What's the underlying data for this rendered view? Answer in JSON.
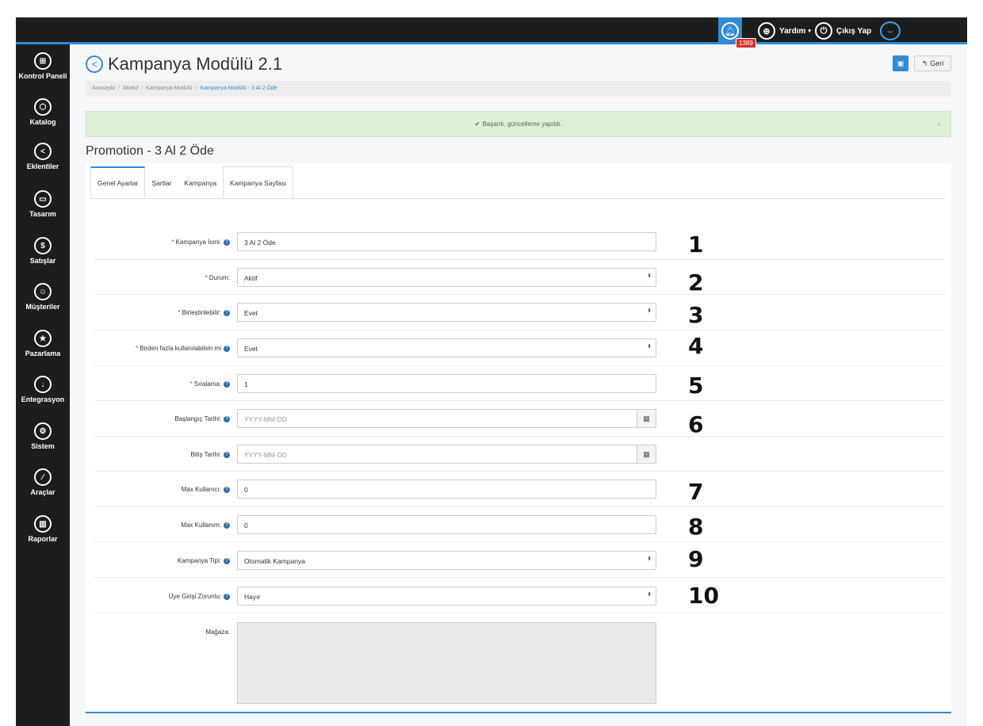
{
  "topbar": {
    "notification_count": "1389",
    "help_label": "Yardım",
    "logout_label": "Çıkış Yap"
  },
  "sidebar": {
    "items": [
      {
        "label": "Kontrol Paneli",
        "icon": "dashboard-icon"
      },
      {
        "label": "Katalog",
        "icon": "catalog-icon"
      },
      {
        "label": "Eklentiler",
        "icon": "extensions-icon"
      },
      {
        "label": "Tasarım",
        "icon": "design-icon"
      },
      {
        "label": "Satışlar",
        "icon": "sales-icon"
      },
      {
        "label": "Müşteriler",
        "icon": "customers-icon"
      },
      {
        "label": "Pazarlama",
        "icon": "marketing-icon"
      },
      {
        "label": "Entegrasyon",
        "icon": "integration-icon"
      },
      {
        "label": "Sistem",
        "icon": "system-icon"
      },
      {
        "label": "Araçlar",
        "icon": "tools-icon"
      },
      {
        "label": "Raporlar",
        "icon": "reports-icon"
      }
    ]
  },
  "header": {
    "title": "Kampanya Modülü 2.1",
    "back_label": "Geri"
  },
  "breadcrumb": [
    "Anasayfa",
    "Modul",
    "Kampanya Modülü",
    "Kampanya Modülü - 3 Al 2 Öde"
  ],
  "alert": {
    "message": "Başarılı, güncelleme yapıldı.",
    "close": "×"
  },
  "section_title": "Promotion - 3 Al 2 Öde",
  "tabs": [
    "Genel Ayarlar",
    "Şartlar",
    "Kampanya",
    "Kampanya Sayfası"
  ],
  "form": {
    "name_label": "Kampanya İsmi:",
    "name_value": "3 Al 2 Öde",
    "status_label": "Durum:",
    "status_value": "Aktif",
    "combinable_label": "Birleştirilebilir:",
    "combinable_value": "Evet",
    "multi_use_label": "Birden fazla kullanılabilsin mi",
    "multi_use_value": "Evet",
    "sort_label": "Sıralama:",
    "sort_value": "1",
    "start_label": "Başlangıç Tarihi:",
    "start_placeholder": "YYYY-MM-DD",
    "end_label": "Bitiş Tarihi:",
    "end_placeholder": "YYYY-MM-DD",
    "max_users_label": "Max Kullanıcı:",
    "max_users_value": "0",
    "max_uses_label": "Max Kullanım:",
    "max_uses_value": "0",
    "type_label": "Kampanya Tipi:",
    "type_value": "Otomatik Kampanya",
    "login_label": "Üye Girişi Zorunlu:",
    "login_value": "Hayır",
    "store_label": "Mağaza:"
  },
  "annotations": [
    "1",
    "2",
    "3",
    "4",
    "5",
    "6",
    "7",
    "8",
    "9",
    "10"
  ],
  "colors": {
    "accent": "#2f8bd8",
    "sidebar_bg": "#1d1d1d",
    "alert_bg": "#dff0d8",
    "required": "#d9302b"
  }
}
